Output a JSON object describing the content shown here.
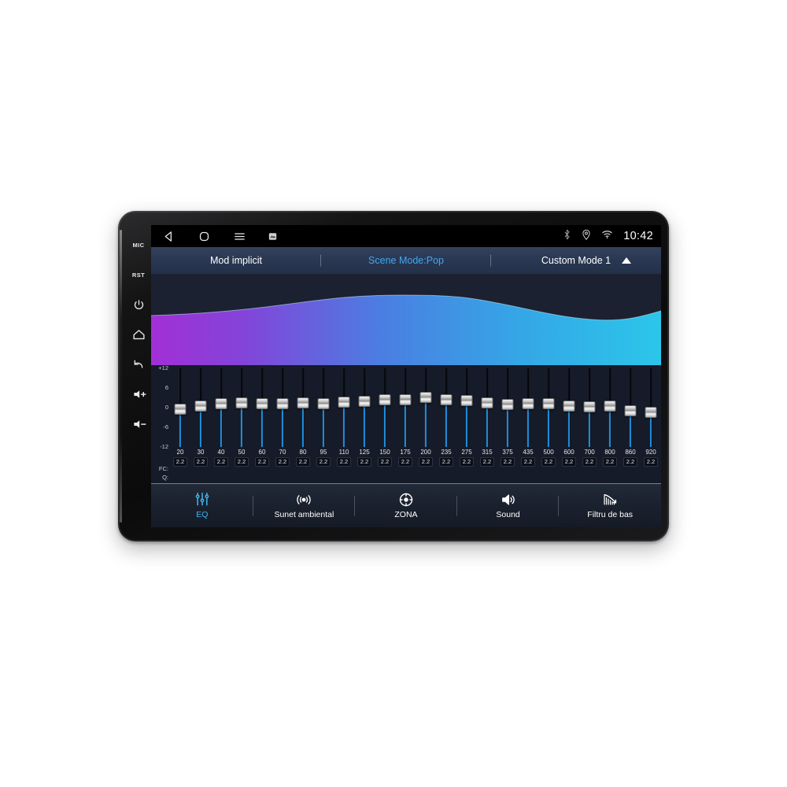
{
  "statusbar": {
    "nav": [
      {
        "name": "back-icon",
        "label": "back"
      },
      {
        "name": "home-icon",
        "label": "home"
      },
      {
        "name": "menu-icon",
        "label": "menu"
      },
      {
        "name": "screenshot-icon",
        "label": "screenshot"
      }
    ],
    "icons": [
      {
        "name": "bluetooth-icon",
        "label": "bluetooth"
      },
      {
        "name": "location-icon",
        "label": "location"
      },
      {
        "name": "wifi-icon",
        "label": "wifi"
      }
    ],
    "clock": "10:42"
  },
  "modebar": {
    "default_mode": "Mod implicit",
    "scene_mode": "Scene Mode:Pop",
    "custom_mode": "Custom Mode 1",
    "expand_arrow": "▲",
    "active_color": "#3fa9f5"
  },
  "wave": {
    "gradient_start": "#9333d6",
    "gradient_mid": "#3f7fe0",
    "gradient_end": "#2bbee8",
    "background": "#1b2130"
  },
  "equalizer": {
    "db_axis": [
      "+12",
      "6",
      "0",
      "-6",
      "-12"
    ],
    "db_min": -12,
    "db_max": 12,
    "fc_label": "FC:",
    "q_label": "Q:",
    "slider_fill_color": "#1f8fe0",
    "bands": [
      {
        "fc": "20",
        "q": "2.2",
        "value": -0.4
      },
      {
        "fc": "30",
        "q": "2.2",
        "value": 0.4
      },
      {
        "fc": "40",
        "q": "2.2",
        "value": 1.1
      },
      {
        "fc": "50",
        "q": "2.2",
        "value": 1.4
      },
      {
        "fc": "60",
        "q": "2.2",
        "value": 1.2
      },
      {
        "fc": "70",
        "q": "2.2",
        "value": 1.3
      },
      {
        "fc": "80",
        "q": "2.2",
        "value": 1.5
      },
      {
        "fc": "95",
        "q": "2.2",
        "value": 1.3
      },
      {
        "fc": "110",
        "q": "2.2",
        "value": 1.6
      },
      {
        "fc": "125",
        "q": "2.2",
        "value": 1.9
      },
      {
        "fc": "150",
        "q": "2.2",
        "value": 2.3
      },
      {
        "fc": "175",
        "q": "2.2",
        "value": 2.5
      },
      {
        "fc": "200",
        "q": "2.2",
        "value": 3.1
      },
      {
        "fc": "235",
        "q": "2.2",
        "value": 2.4
      },
      {
        "fc": "275",
        "q": "2.2",
        "value": 2.2
      },
      {
        "fc": "315",
        "q": "2.2",
        "value": 1.4
      },
      {
        "fc": "375",
        "q": "2.2",
        "value": 1.0
      },
      {
        "fc": "435",
        "q": "2.2",
        "value": 1.3
      },
      {
        "fc": "500",
        "q": "2.2",
        "value": 1.2
      },
      {
        "fc": "600",
        "q": "2.2",
        "value": 0.5
      },
      {
        "fc": "700",
        "q": "2.2",
        "value": 0.3
      },
      {
        "fc": "800",
        "q": "2.2",
        "value": 0.4
      },
      {
        "fc": "860",
        "q": "2.2",
        "value": -0.9
      },
      {
        "fc": "920",
        "q": "2.2",
        "value": -1.4
      }
    ]
  },
  "tabs": [
    {
      "label": "EQ",
      "icon": "equalizer-icon",
      "active": true
    },
    {
      "label": "Sunet ambiental",
      "icon": "surround-icon",
      "active": false
    },
    {
      "label": "ZONA",
      "icon": "zone-target-icon",
      "active": false
    },
    {
      "label": "Sound",
      "icon": "speaker-icon",
      "active": false
    },
    {
      "label": "Filtru de bas",
      "icon": "bass-filter-icon",
      "active": false
    }
  ],
  "hardkeys": [
    {
      "name": "mic-key",
      "label": "MIC"
    },
    {
      "name": "reset-key",
      "label": "RST"
    },
    {
      "name": "power-key",
      "label": ""
    },
    {
      "name": "home-key",
      "label": ""
    },
    {
      "name": "back-key",
      "label": ""
    },
    {
      "name": "volume-up-key",
      "label": ""
    },
    {
      "name": "volume-down-key",
      "label": ""
    }
  ]
}
